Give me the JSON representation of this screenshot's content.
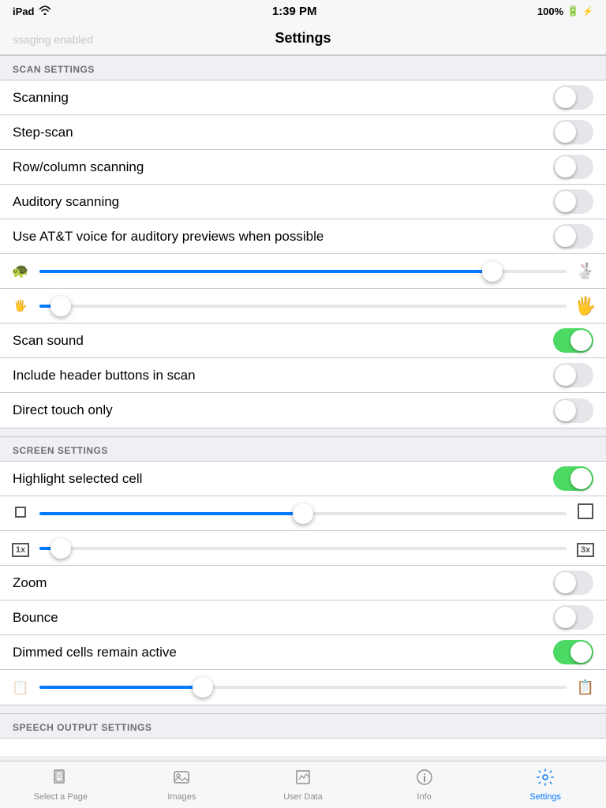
{
  "statusBar": {
    "carrier": "iPad",
    "wifi": true,
    "time": "1:39 PM",
    "battery": "100%",
    "charging": true,
    "watermark": "ssaging enabled"
  },
  "navBar": {
    "title": "Settings"
  },
  "sections": [
    {
      "id": "scan-settings",
      "header": "SCAN SETTINGS",
      "rows": [
        {
          "id": "scanning",
          "type": "toggle",
          "label": "Scanning",
          "state": "off"
        },
        {
          "id": "step-scan",
          "type": "toggle",
          "label": "Step-scan",
          "state": "off"
        },
        {
          "id": "row-column-scanning",
          "type": "toggle",
          "label": "Row/column scanning",
          "state": "off"
        },
        {
          "id": "auditory-scanning",
          "type": "toggle",
          "label": "Auditory scanning",
          "state": "off"
        },
        {
          "id": "att-voice",
          "type": "toggle",
          "label": "Use AT&T voice for auditory previews when possible",
          "state": "off"
        },
        {
          "id": "speed-slider",
          "type": "slider",
          "leftIcon": "turtle",
          "rightIcon": "rabbit",
          "fillPercent": 86,
          "thumbPercent": 86
        },
        {
          "id": "size-slider",
          "type": "slider",
          "leftIcon": "hand-small",
          "rightIcon": "hand-large",
          "fillPercent": 4,
          "thumbPercent": 4
        },
        {
          "id": "scan-sound",
          "type": "toggle",
          "label": "Scan sound",
          "state": "on"
        },
        {
          "id": "include-header",
          "type": "toggle",
          "label": "Include header buttons in scan",
          "state": "off"
        },
        {
          "id": "direct-touch",
          "type": "toggle",
          "label": "Direct touch only",
          "state": "off"
        }
      ]
    },
    {
      "id": "screen-settings",
      "header": "SCREEN SETTINGS",
      "rows": [
        {
          "id": "highlight-selected",
          "type": "toggle",
          "label": "Highlight selected cell",
          "state": "on"
        },
        {
          "id": "border-size-slider",
          "type": "slider",
          "leftIcon": "square-small",
          "rightIcon": "square-large",
          "fillPercent": 50,
          "thumbPercent": 50
        },
        {
          "id": "zoom-level-slider",
          "type": "slider",
          "leftIcon": "badge-1x",
          "rightIcon": "badge-3x",
          "fillPercent": 4,
          "thumbPercent": 4
        },
        {
          "id": "zoom",
          "type": "toggle",
          "label": "Zoom",
          "state": "off"
        },
        {
          "id": "bounce",
          "type": "toggle",
          "label": "Bounce",
          "state": "off"
        },
        {
          "id": "dimmed-cells",
          "type": "toggle",
          "label": "Dimmed cells remain active",
          "state": "on"
        },
        {
          "id": "opacity-slider",
          "type": "slider",
          "leftIcon": "opacity-low",
          "rightIcon": "opacity-high",
          "fillPercent": 31,
          "thumbPercent": 31
        }
      ]
    },
    {
      "id": "speech-output-settings",
      "header": "SPEECH OUTPUT SETTINGS",
      "rows": []
    }
  ],
  "tabBar": {
    "items": [
      {
        "id": "select-a-page",
        "label": "Select a Page",
        "icon": "pages-icon",
        "active": false
      },
      {
        "id": "images",
        "label": "Images",
        "icon": "images-icon",
        "active": false
      },
      {
        "id": "user-data",
        "label": "User Data",
        "icon": "userdata-icon",
        "active": false
      },
      {
        "id": "info",
        "label": "Info",
        "icon": "info-icon",
        "active": false
      },
      {
        "id": "settings",
        "label": "Settings",
        "icon": "settings-icon",
        "active": true
      }
    ]
  }
}
